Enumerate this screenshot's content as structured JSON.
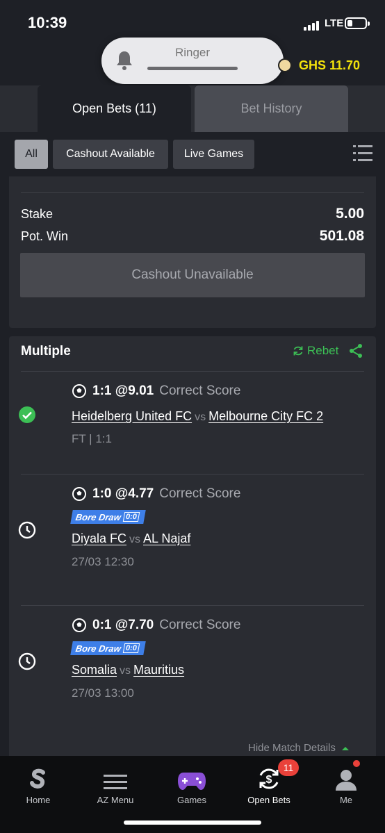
{
  "status": {
    "time": "10:39",
    "network": "LTE"
  },
  "ringer": {
    "label": "Ringer"
  },
  "account": {
    "balance": "GHS 11.70"
  },
  "tabs": {
    "open_bets": "Open Bets (11)",
    "bet_history": "Bet History"
  },
  "filters": [
    "All",
    "Cashout Available",
    "Live Games"
  ],
  "previous_bet": {
    "stake_label": "Stake",
    "stake_value": "5.00",
    "potwin_label": "Pot. Win",
    "potwin_value": "501.08",
    "cashout_label": "Cashout Unavailable"
  },
  "multiple_bet": {
    "title": "Multiple",
    "rebet_label": "Rebet",
    "legs": [
      {
        "status": "won",
        "pick": "1:1 @9.01",
        "market": "Correct Score",
        "home": "Heidelberg United FC",
        "vs": "vs",
        "away": "Melbourne City FC 2",
        "info": "FT | 1:1",
        "tag": ""
      },
      {
        "status": "pending",
        "pick": "1:0 @4.77",
        "market": "Correct Score",
        "home": "Diyala FC",
        "vs": "vs",
        "away": "AL Najaf",
        "info": "27/03 12:30",
        "tag": "Bore Draw",
        "tag_score": "0:0"
      },
      {
        "status": "pending",
        "pick": "0:1 @7.70",
        "market": "Correct Score",
        "home": "Somalia",
        "vs": "vs",
        "away": "Mauritius",
        "info": "27/03 13:00",
        "tag": "Bore Draw",
        "tag_score": "0:0"
      }
    ],
    "hide_details": "Hide Match Details"
  },
  "bottom_nav": {
    "items": [
      "Home",
      "AZ Menu",
      "Games",
      "Open Bets",
      "Me"
    ],
    "open_bets_count": "11"
  },
  "colors": {
    "balance": "#f2e20c",
    "rebet": "#3cbf55",
    "won": "#3cbf55",
    "tag": "#3e7fe8",
    "badge": "#e9413a"
  }
}
